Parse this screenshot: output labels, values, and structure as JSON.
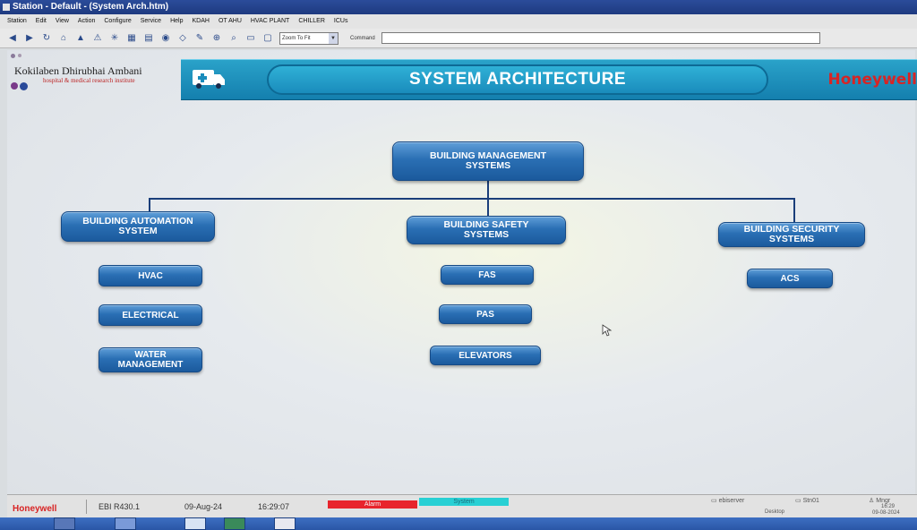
{
  "window": {
    "title": "Station - Default - (System Arch.htm)"
  },
  "menu": [
    "Station",
    "Edit",
    "View",
    "Action",
    "Configure",
    "Service",
    "Help",
    "KDAH",
    "OT AHU",
    "HVAC PLANT",
    "CHILLER",
    "ICUs"
  ],
  "toolbar": {
    "zoom_value": "Zoom To Fit",
    "command_label": "Command",
    "command_value": ""
  },
  "header": {
    "hospital_name": "Kokilaben Dhirubhai Ambani",
    "hospital_sub": "hospital & medical research institute",
    "title": "SYSTEM ARCHITECTURE",
    "brand": "Honeywell"
  },
  "tree": {
    "root": "BUILDING MANAGEMENT SYSTEMS",
    "branches": [
      {
        "label": "BUILDING AUTOMATION SYSTEM",
        "items": [
          "HVAC",
          "ELECTRICAL",
          "WATER MANAGEMENT"
        ]
      },
      {
        "label": "BUILDING SAFETY SYSTEMS",
        "items": [
          "FAS",
          "PAS",
          "ELEVATORS"
        ]
      },
      {
        "label": "BUILDING SECURITY SYSTEMS",
        "items": [
          "ACS"
        ]
      }
    ]
  },
  "status": {
    "brand": "Honeywell",
    "version": "EBI R430.1",
    "date": "09-Aug-24",
    "time": "16:29:07",
    "alarm": "Alarm",
    "system": "System",
    "server": "ebiserver",
    "station": "Stn01",
    "user": "Mngr",
    "desktop": "Desktop",
    "clock_time": "16:29",
    "clock_date": "09-08-2024"
  },
  "colors": {
    "header_band": "#1a8cbc",
    "node": "#2a6fb4",
    "brand": "#d82424",
    "alarm": "#e8242c",
    "system": "#28d0d4"
  }
}
